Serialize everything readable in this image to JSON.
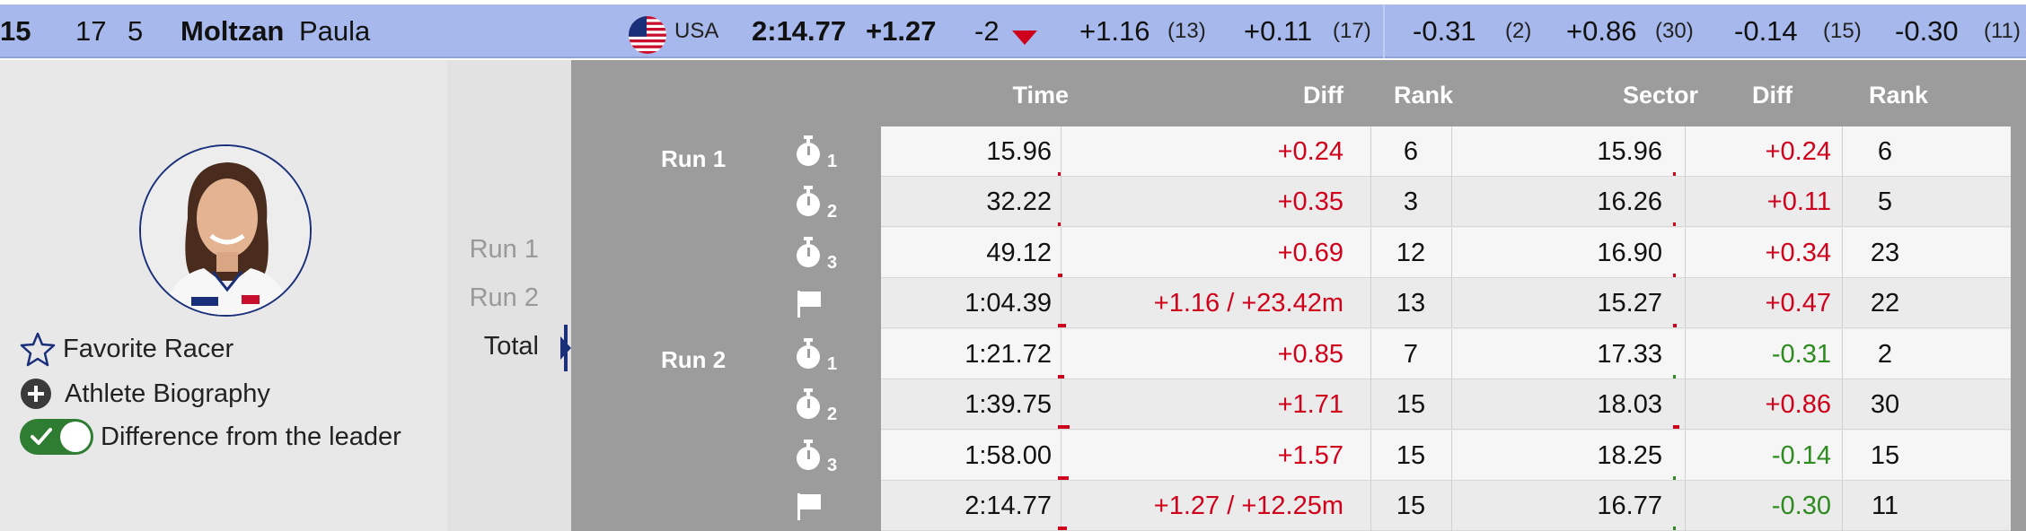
{
  "athlete": {
    "bib": "15",
    "start_no": "17",
    "rank_no": "5",
    "last_name": "Moltzan",
    "first_name": "Paula",
    "country": "USA",
    "time": "2:14.77",
    "diff": "+1.27",
    "pos_change": "-2",
    "splits": [
      {
        "value": "+1.16",
        "rank": "(13)"
      },
      {
        "value": "+0.11",
        "rank": "(17)"
      },
      {
        "value": "-0.31",
        "rank": "(2)"
      },
      {
        "value": "+0.86",
        "rank": "(30)"
      },
      {
        "value": "-0.14",
        "rank": "(15)"
      },
      {
        "value": "-0.30",
        "rank": "(11)"
      }
    ]
  },
  "options": {
    "favorite": "Favorite Racer",
    "biography": "Athlete Biography",
    "difference": "Difference from the leader",
    "difference_enabled": true
  },
  "run_selector": {
    "run1": "Run 1",
    "run2": "Run 2",
    "total": "Total",
    "active": "Total"
  },
  "table": {
    "headers": {
      "time": "Time",
      "diff": "Diff",
      "rank": "Rank",
      "sector": "Sector",
      "sector_diff": "Diff",
      "sector_rank": "Rank"
    },
    "run1_label": "Run 1",
    "run2_label": "Run 2",
    "rows": [
      {
        "icon": "stopwatch-icon",
        "sub": "1",
        "time": "15.96",
        "diff": "+0.24",
        "rank": "6",
        "sector": "15.96",
        "sector_diff": "+0.24",
        "sector_rank": "6"
      },
      {
        "icon": "stopwatch-icon",
        "sub": "2",
        "time": "32.22",
        "diff": "+0.35",
        "rank": "3",
        "sector": "16.26",
        "sector_diff": "+0.11",
        "sector_rank": "5"
      },
      {
        "icon": "stopwatch-icon",
        "sub": "3",
        "time": "49.12",
        "diff": "+0.69",
        "rank": "12",
        "sector": "16.90",
        "sector_diff": "+0.34",
        "sector_rank": "23"
      },
      {
        "icon": "finish-flag-icon",
        "sub": "",
        "time": "1:04.39",
        "diff": "+1.16 / +23.42m",
        "rank": "13",
        "sector": "15.27",
        "sector_diff": "+0.47",
        "sector_rank": "22"
      },
      {
        "icon": "stopwatch-icon",
        "sub": "1",
        "time": "1:21.72",
        "diff": "+0.85",
        "rank": "7",
        "sector": "17.33",
        "sector_diff": "-0.31",
        "sector_rank": "2"
      },
      {
        "icon": "stopwatch-icon",
        "sub": "2",
        "time": "1:39.75",
        "diff": "+1.71",
        "rank": "15",
        "sector": "18.03",
        "sector_diff": "+0.86",
        "sector_rank": "30"
      },
      {
        "icon": "stopwatch-icon",
        "sub": "3",
        "time": "1:58.00",
        "diff": "+1.57",
        "rank": "15",
        "sector": "18.25",
        "sector_diff": "-0.14",
        "sector_rank": "15"
      },
      {
        "icon": "finish-flag-icon",
        "sub": "",
        "time": "2:14.77",
        "diff": "+1.27 / +12.25m",
        "rank": "15",
        "sector": "16.77",
        "sector_diff": "-0.30",
        "sector_rank": "11"
      }
    ]
  },
  "colors": {
    "positive": "#d0021b",
    "negative": "#2e8b1f",
    "highlight_row": "#a6b8ec",
    "accent": "#1a2f7a"
  }
}
